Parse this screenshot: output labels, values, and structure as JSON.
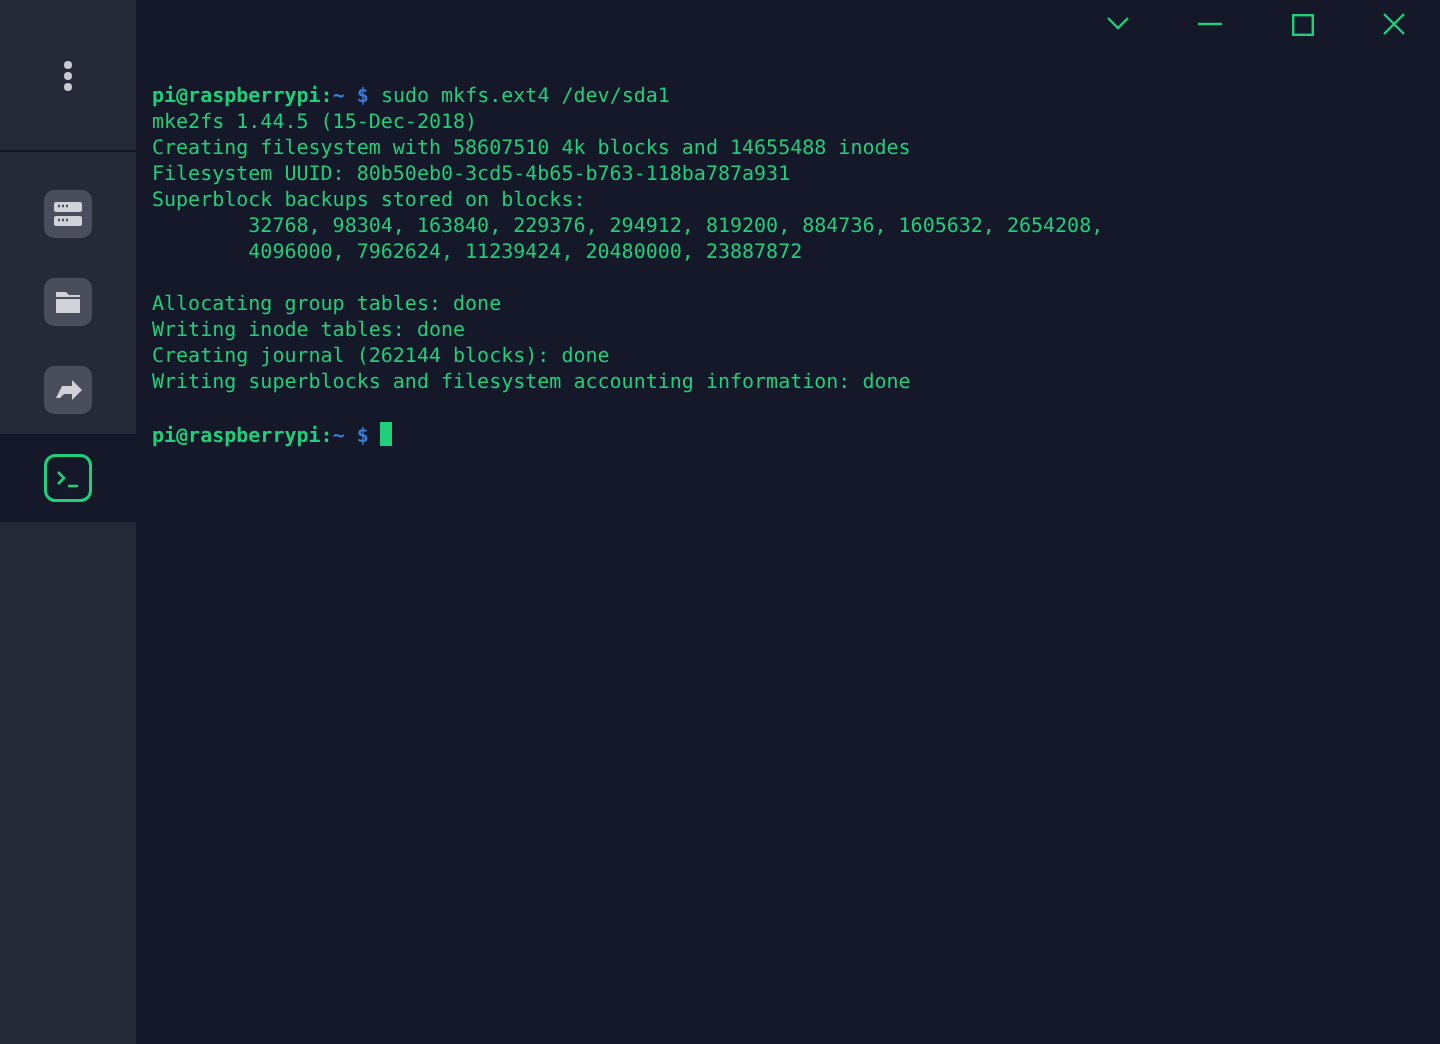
{
  "sidebar": {
    "items": [
      {
        "kind": "server",
        "selected": false
      },
      {
        "kind": "folder",
        "selected": false
      },
      {
        "kind": "share",
        "selected": false
      },
      {
        "kind": "terminal",
        "selected": true
      }
    ]
  },
  "terminal": {
    "blocks": [
      [
        {
          "kind": "prompt",
          "host": "pi@raspberrypi:",
          "path": "~",
          "symbol": "$",
          "command": "sudo mkfs.ext4 /dev/sda1"
        },
        {
          "kind": "output",
          "text": "mke2fs 1.44.5 (15-Dec-2018)"
        },
        {
          "kind": "output",
          "text": "Creating filesystem with 58607510 4k blocks and 14655488 inodes"
        },
        {
          "kind": "output",
          "text": "Filesystem UUID: 80b50eb0-3cd5-4b65-b763-118ba787a931"
        },
        {
          "kind": "output",
          "text": "Superblock backups stored on blocks:"
        },
        {
          "kind": "output",
          "text": "        32768, 98304, 163840, 229376, 294912, 819200, 884736, 1605632, 2654208,"
        },
        {
          "kind": "output",
          "text": "        4096000, 7962624, 11239424, 20480000, 23887872"
        }
      ],
      [
        {
          "kind": "output",
          "text": "Allocating group tables: done"
        },
        {
          "kind": "output",
          "text": "Writing inode tables: done"
        },
        {
          "kind": "output",
          "text": "Creating journal (262144 blocks): done"
        },
        {
          "kind": "output",
          "text": "Writing superblocks and filesystem accounting information: done"
        }
      ],
      [
        {
          "kind": "prompt",
          "host": "pi@raspberrypi:",
          "path": "~",
          "symbol": "$",
          "cursor": true
        }
      ]
    ]
  }
}
